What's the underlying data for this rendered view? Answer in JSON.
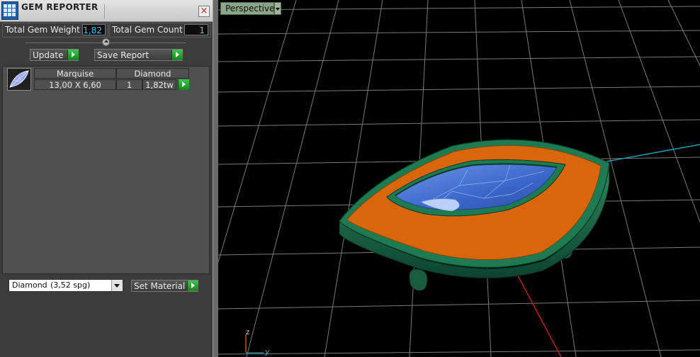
{
  "window": {
    "title": "GEM REPORTER",
    "close_glyph": "×"
  },
  "stats": {
    "weight_label": "Total Gem Weight",
    "weight_value": "1,82",
    "count_label": "Total Gem Count",
    "count_value": "1"
  },
  "buttons": {
    "update": "Update",
    "save_report": "Save Report",
    "set_material": "Set Material"
  },
  "gem_list": {
    "rows": [
      {
        "shape": "Marquise",
        "material": "Diamond",
        "size": "13,00 X 6,60",
        "count": "1",
        "weight": "1,82tw"
      }
    ]
  },
  "material_select": {
    "name": "Diamond",
    "density": "(3,52 spg)"
  },
  "viewport": {
    "view_label": "Perspective",
    "axis_z": "z",
    "axis_y": "y"
  },
  "colors": {
    "accent_green": "#2aa33a",
    "value_cyan": "#39c6f0",
    "metal_green": "#1f6e4a",
    "gem_orange": "#d9660a",
    "stone_blue": "#3a6ed0"
  }
}
